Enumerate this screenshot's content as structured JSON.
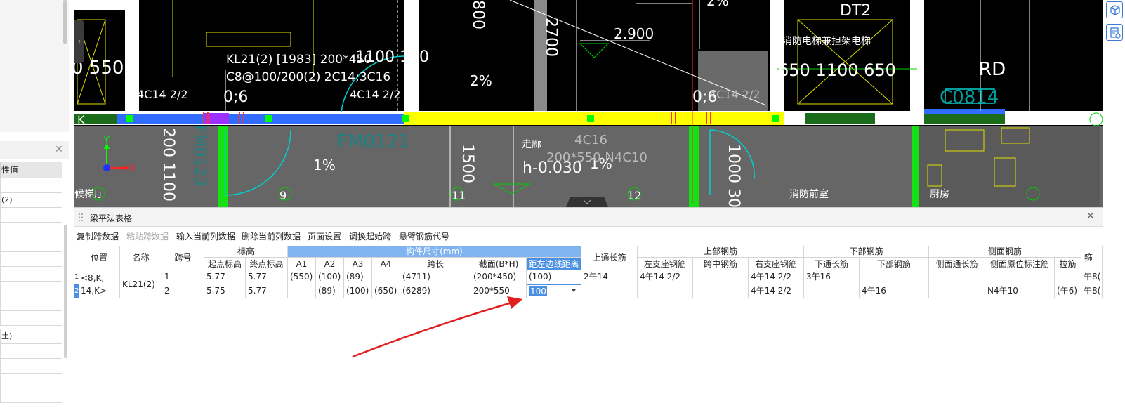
{
  "left_panel": {
    "column_header": "性值",
    "rows": [
      "",
      "(2)",
      "",
      "",
      "",
      "",
      "",
      "",
      "",
      "",
      "土)",
      "",
      "",
      "",
      ""
    ]
  },
  "cad": {
    "texts": {
      "beam_label_line1": "KL21(2) [1983] 200*450",
      "beam_label_line2": "C8@100/200(2) 2C14;3C16",
      "left_rebar": "4C14 2/2",
      "mid_rebar": "4C14 2/2",
      "right_rebar": "4C14 2/2",
      "zero_six_left": "0;6",
      "zero_six_right": "0;6",
      "dim_550": "0 550",
      "dim_1100_150": "1100 150",
      "dim_800": "800",
      "dim_2700": "2700",
      "elev_2900": "2.900",
      "pct_top": "2%",
      "pct_mid": "2%",
      "dt2": "DT2",
      "elevator_note": "消防电梯兼担架电梯",
      "dim_650_1100_650": "650 1100 650",
      "rd": "RD",
      "c0814": "C0814",
      "k_left": "K",
      "k_right": "K",
      "fm0121": "FM0121",
      "fm0123": "FM0123",
      "axis_y": "Y",
      "axis_x": "X",
      "dim_200_1100": "200 1100 20",
      "pct_1_a": "1%",
      "pct_1_b": "1%",
      "dim_1500": "1500",
      "corridor": "走廊",
      "beam_4c16": "4C16",
      "beam_n4c10": "200*550 N4C10",
      "h_elev": "h-0.030",
      "dim_1000_30": "1000 30",
      "room_left": "候梯厅",
      "room_mid": "消防前室",
      "room_right": "厨房",
      "num_9": "9",
      "num_11": "11",
      "num_12": "12"
    }
  },
  "panel": {
    "title": "梁平法表格",
    "toolbar": {
      "copy_span": "复制跨数据",
      "paste_span": "粘贴跨数据",
      "input_col": "输入当前列数据",
      "delete_col": "删除当前列数据",
      "page_setup": "页面设置",
      "swap_start": "调换起始跨",
      "cantilever_code": "悬臂钢筋代号"
    },
    "headers": {
      "position": "位置",
      "name": "名称",
      "span_no": "跨号",
      "elevation": "标高",
      "start_elev": "起点标高",
      "end_elev": "终点标高",
      "component_size": "构件尺寸(mm)",
      "a1": "A1",
      "a2": "A2",
      "a3": "A3",
      "a4": "A4",
      "span_length": "跨长",
      "section": "截面(B*H)",
      "edge_distance": "距左边线距离",
      "top_continuous": "上通长筋",
      "top_rebar": "上部钢筋",
      "left_support": "左支座钢筋",
      "mid_span": "跨中钢筋",
      "right_support": "右支座钢筋",
      "bottom_rebar": "下部钢筋",
      "bottom_continuous": "下通长筋",
      "bottom_rebar_sub": "下部钢筋",
      "side_rebar": "侧面钢筋",
      "side_continuous": "侧面通长筋",
      "side_original": "侧面原位标注筋",
      "tie_bar": "拉筋",
      "stirrup_partial": "箍"
    },
    "rows": [
      {
        "num": "1",
        "position": "<8,K;",
        "name": "KL21(2)",
        "span": "1",
        "start_elev": "5.77",
        "end_elev": "5.77",
        "a1": "(550)",
        "a2": "(100)",
        "a3": "(89)",
        "a4": "",
        "span_length": "(4711)",
        "section": "(200*450)",
        "edge_distance": "(100)",
        "top_continuous": "2午14",
        "left_support": "4午14 2/2",
        "mid_span": "",
        "right_support": "4午14 2/2",
        "bottom_continuous": "3午16",
        "bottom_rebar": "",
        "side_continuous": "",
        "side_original": "",
        "tie_bar": "",
        "stirrup": "午8("
      },
      {
        "num": "2",
        "position": "14,K>",
        "name": "",
        "span": "2",
        "start_elev": "5.75",
        "end_elev": "5.77",
        "a1": "",
        "a2": "(89)",
        "a3": "(100)",
        "a4": "(650)",
        "span_length": "(6289)",
        "section": "200*550",
        "edge_distance": "100",
        "top_continuous": "",
        "left_support": "",
        "mid_span": "",
        "right_support": "4午14 2/2",
        "bottom_continuous": "",
        "bottom_rebar": "4午16",
        "side_continuous": "",
        "side_original": "N4午10",
        "tie_bar": "(午6)",
        "stirrup": "午8("
      }
    ]
  },
  "colors": {
    "cad_background": "#000000",
    "beam_yellow": "#ffff00",
    "beam_blue": "#2f6cff",
    "header_selected": "#7fb4f0",
    "annotation_arrow": "#e02020"
  }
}
